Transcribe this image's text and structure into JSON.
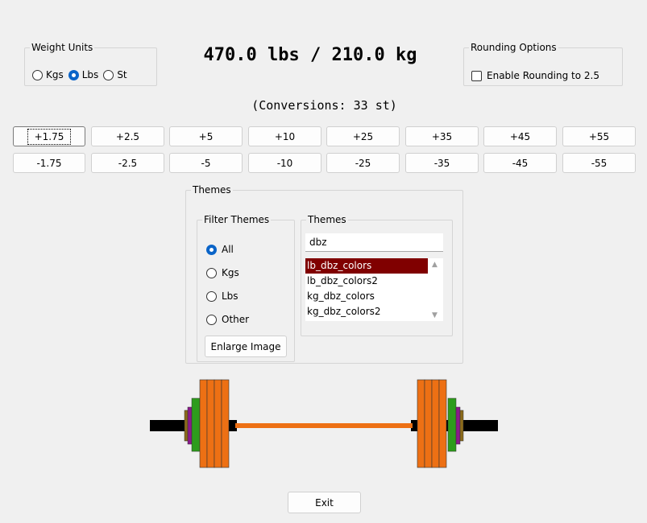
{
  "weight_units": {
    "legend": "Weight Units",
    "options": [
      "Kgs",
      "Lbs",
      "St"
    ],
    "selected": "Lbs"
  },
  "display": {
    "main": "470.0 lbs / 210.0 kg",
    "conversions": "(Conversions: 33 st)"
  },
  "rounding": {
    "legend": "Rounding Options",
    "checkbox_label": "Enable Rounding to 2.5",
    "checked": false
  },
  "increment_buttons": [
    "+1.75",
    "+2.5",
    "+5",
    "+10",
    "+25",
    "+35",
    "+45",
    "+55"
  ],
  "decrement_buttons": [
    "-1.75",
    "-2.5",
    "-5",
    "-10",
    "-25",
    "-35",
    "-45",
    "-55"
  ],
  "themes": {
    "legend": "Themes",
    "filter": {
      "legend": "Filter Themes",
      "options": [
        "All",
        "Kgs",
        "Lbs",
        "Other"
      ],
      "selected": "All"
    },
    "enlarge_label": "Enlarge Image",
    "list": {
      "legend": "Themes",
      "search_value": "dbz",
      "items": [
        "lb_dbz_colors",
        "lb_dbz_colors2",
        "kg_dbz_colors",
        "kg_dbz_colors2"
      ],
      "selected": "lb_dbz_colors"
    }
  },
  "barbell_colors": {
    "bar": "#ed7014",
    "sleeve": "#000000",
    "plate_large": "#ed7014",
    "plate_medium": "#2e9c1c",
    "plate_small": "#8b1a8b",
    "plate_tiny": "#8b6a1a",
    "selection": "#800000",
    "accent": "#0a64c8"
  },
  "exit_label": "Exit"
}
